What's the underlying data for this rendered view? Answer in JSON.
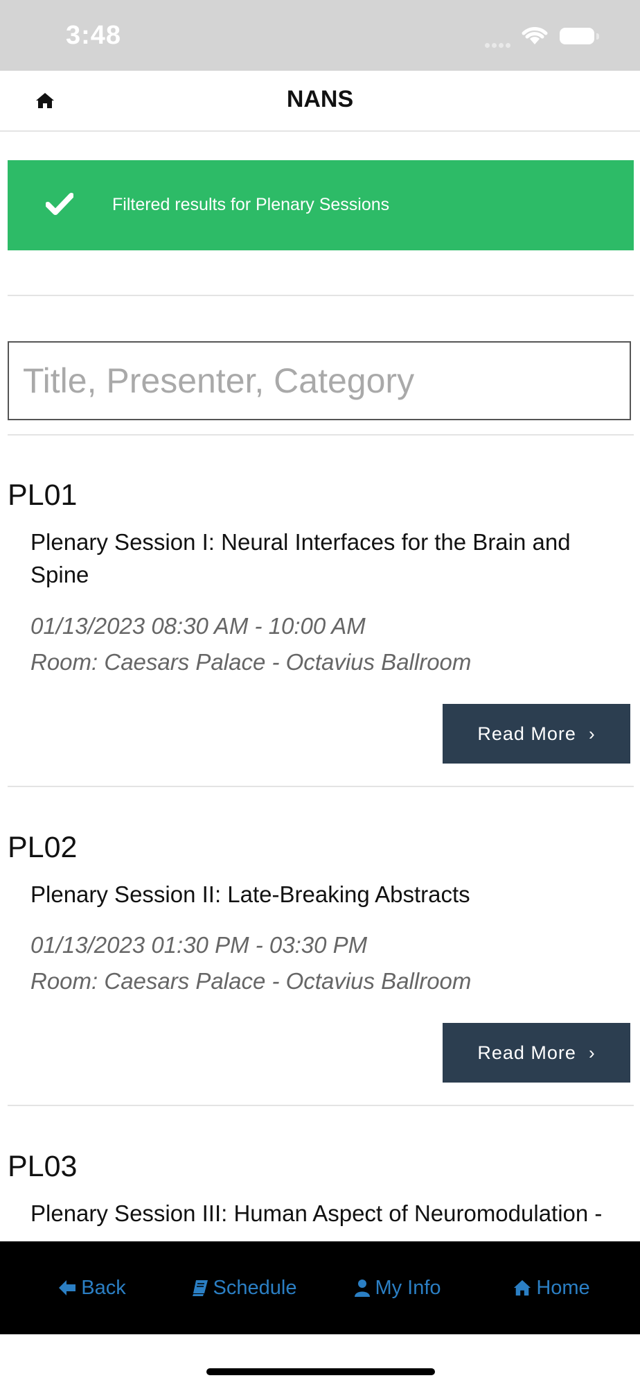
{
  "status_bar": {
    "time": "3:48"
  },
  "navbar": {
    "title": "NANS"
  },
  "alert": {
    "message": "Filtered results for Plenary Sessions"
  },
  "search": {
    "placeholder": "Title, Presenter, Category",
    "value": ""
  },
  "sessions": [
    {
      "code": "PL01",
      "title": "Plenary Session I: Neural Interfaces for the Brain and Spine",
      "when": "01/13/2023 08:30 AM - 10:00 AM",
      "room": "Room: Caesars Palace - Octavius Ballroom",
      "button": "Read More"
    },
    {
      "code": "PL02",
      "title": "Plenary Session II: Late-Breaking Abstracts",
      "when": "01/13/2023 01:30 PM - 03:30 PM",
      "room": "Room: Caesars Palace - Octavius Ballroom",
      "button": "Read More"
    },
    {
      "code": "PL03",
      "title": "Plenary Session III: Human Aspect of Neuromodulation -"
    }
  ],
  "tabbar": {
    "back": "Back",
    "schedule": "Schedule",
    "my_info": "My Info",
    "home": "Home"
  },
  "colors": {
    "alert_green": "#2dbb67",
    "button_navy": "#2c3e50",
    "tab_blue": "#2b7fc4"
  }
}
